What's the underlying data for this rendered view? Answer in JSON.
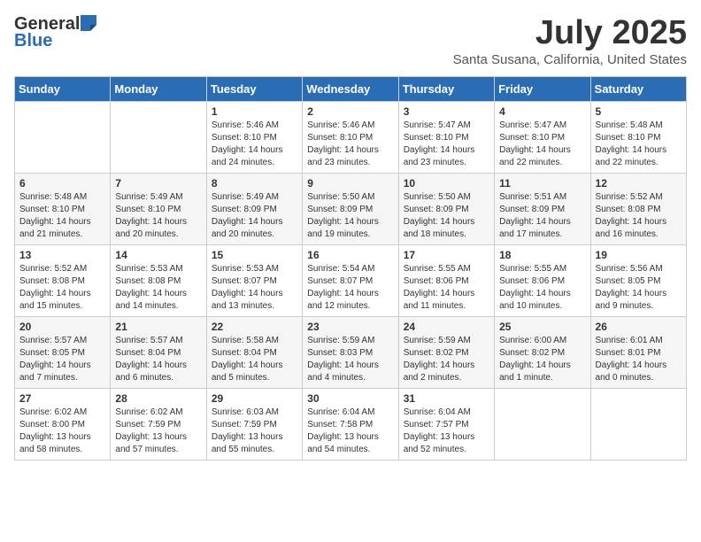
{
  "logo": {
    "general": "General",
    "blue": "Blue"
  },
  "title": "July 2025",
  "subtitle": "Santa Susana, California, United States",
  "headers": [
    "Sunday",
    "Monday",
    "Tuesday",
    "Wednesday",
    "Thursday",
    "Friday",
    "Saturday"
  ],
  "weeks": [
    [
      {
        "day": "",
        "sunrise": "",
        "sunset": "",
        "daylight": ""
      },
      {
        "day": "",
        "sunrise": "",
        "sunset": "",
        "daylight": ""
      },
      {
        "day": "1",
        "sunrise": "Sunrise: 5:46 AM",
        "sunset": "Sunset: 8:10 PM",
        "daylight": "Daylight: 14 hours and 24 minutes."
      },
      {
        "day": "2",
        "sunrise": "Sunrise: 5:46 AM",
        "sunset": "Sunset: 8:10 PM",
        "daylight": "Daylight: 14 hours and 23 minutes."
      },
      {
        "day": "3",
        "sunrise": "Sunrise: 5:47 AM",
        "sunset": "Sunset: 8:10 PM",
        "daylight": "Daylight: 14 hours and 23 minutes."
      },
      {
        "day": "4",
        "sunrise": "Sunrise: 5:47 AM",
        "sunset": "Sunset: 8:10 PM",
        "daylight": "Daylight: 14 hours and 22 minutes."
      },
      {
        "day": "5",
        "sunrise": "Sunrise: 5:48 AM",
        "sunset": "Sunset: 8:10 PM",
        "daylight": "Daylight: 14 hours and 22 minutes."
      }
    ],
    [
      {
        "day": "6",
        "sunrise": "Sunrise: 5:48 AM",
        "sunset": "Sunset: 8:10 PM",
        "daylight": "Daylight: 14 hours and 21 minutes."
      },
      {
        "day": "7",
        "sunrise": "Sunrise: 5:49 AM",
        "sunset": "Sunset: 8:10 PM",
        "daylight": "Daylight: 14 hours and 20 minutes."
      },
      {
        "day": "8",
        "sunrise": "Sunrise: 5:49 AM",
        "sunset": "Sunset: 8:09 PM",
        "daylight": "Daylight: 14 hours and 20 minutes."
      },
      {
        "day": "9",
        "sunrise": "Sunrise: 5:50 AM",
        "sunset": "Sunset: 8:09 PM",
        "daylight": "Daylight: 14 hours and 19 minutes."
      },
      {
        "day": "10",
        "sunrise": "Sunrise: 5:50 AM",
        "sunset": "Sunset: 8:09 PM",
        "daylight": "Daylight: 14 hours and 18 minutes."
      },
      {
        "day": "11",
        "sunrise": "Sunrise: 5:51 AM",
        "sunset": "Sunset: 8:09 PM",
        "daylight": "Daylight: 14 hours and 17 minutes."
      },
      {
        "day": "12",
        "sunrise": "Sunrise: 5:52 AM",
        "sunset": "Sunset: 8:08 PM",
        "daylight": "Daylight: 14 hours and 16 minutes."
      }
    ],
    [
      {
        "day": "13",
        "sunrise": "Sunrise: 5:52 AM",
        "sunset": "Sunset: 8:08 PM",
        "daylight": "Daylight: 14 hours and 15 minutes."
      },
      {
        "day": "14",
        "sunrise": "Sunrise: 5:53 AM",
        "sunset": "Sunset: 8:08 PM",
        "daylight": "Daylight: 14 hours and 14 minutes."
      },
      {
        "day": "15",
        "sunrise": "Sunrise: 5:53 AM",
        "sunset": "Sunset: 8:07 PM",
        "daylight": "Daylight: 14 hours and 13 minutes."
      },
      {
        "day": "16",
        "sunrise": "Sunrise: 5:54 AM",
        "sunset": "Sunset: 8:07 PM",
        "daylight": "Daylight: 14 hours and 12 minutes."
      },
      {
        "day": "17",
        "sunrise": "Sunrise: 5:55 AM",
        "sunset": "Sunset: 8:06 PM",
        "daylight": "Daylight: 14 hours and 11 minutes."
      },
      {
        "day": "18",
        "sunrise": "Sunrise: 5:55 AM",
        "sunset": "Sunset: 8:06 PM",
        "daylight": "Daylight: 14 hours and 10 minutes."
      },
      {
        "day": "19",
        "sunrise": "Sunrise: 5:56 AM",
        "sunset": "Sunset: 8:05 PM",
        "daylight": "Daylight: 14 hours and 9 minutes."
      }
    ],
    [
      {
        "day": "20",
        "sunrise": "Sunrise: 5:57 AM",
        "sunset": "Sunset: 8:05 PM",
        "daylight": "Daylight: 14 hours and 7 minutes."
      },
      {
        "day": "21",
        "sunrise": "Sunrise: 5:57 AM",
        "sunset": "Sunset: 8:04 PM",
        "daylight": "Daylight: 14 hours and 6 minutes."
      },
      {
        "day": "22",
        "sunrise": "Sunrise: 5:58 AM",
        "sunset": "Sunset: 8:04 PM",
        "daylight": "Daylight: 14 hours and 5 minutes."
      },
      {
        "day": "23",
        "sunrise": "Sunrise: 5:59 AM",
        "sunset": "Sunset: 8:03 PM",
        "daylight": "Daylight: 14 hours and 4 minutes."
      },
      {
        "day": "24",
        "sunrise": "Sunrise: 5:59 AM",
        "sunset": "Sunset: 8:02 PM",
        "daylight": "Daylight: 14 hours and 2 minutes."
      },
      {
        "day": "25",
        "sunrise": "Sunrise: 6:00 AM",
        "sunset": "Sunset: 8:02 PM",
        "daylight": "Daylight: 14 hours and 1 minute."
      },
      {
        "day": "26",
        "sunrise": "Sunrise: 6:01 AM",
        "sunset": "Sunset: 8:01 PM",
        "daylight": "Daylight: 14 hours and 0 minutes."
      }
    ],
    [
      {
        "day": "27",
        "sunrise": "Sunrise: 6:02 AM",
        "sunset": "Sunset: 8:00 PM",
        "daylight": "Daylight: 13 hours and 58 minutes."
      },
      {
        "day": "28",
        "sunrise": "Sunrise: 6:02 AM",
        "sunset": "Sunset: 7:59 PM",
        "daylight": "Daylight: 13 hours and 57 minutes."
      },
      {
        "day": "29",
        "sunrise": "Sunrise: 6:03 AM",
        "sunset": "Sunset: 7:59 PM",
        "daylight": "Daylight: 13 hours and 55 minutes."
      },
      {
        "day": "30",
        "sunrise": "Sunrise: 6:04 AM",
        "sunset": "Sunset: 7:58 PM",
        "daylight": "Daylight: 13 hours and 54 minutes."
      },
      {
        "day": "31",
        "sunrise": "Sunrise: 6:04 AM",
        "sunset": "Sunset: 7:57 PM",
        "daylight": "Daylight: 13 hours and 52 minutes."
      },
      {
        "day": "",
        "sunrise": "",
        "sunset": "",
        "daylight": ""
      },
      {
        "day": "",
        "sunrise": "",
        "sunset": "",
        "daylight": ""
      }
    ]
  ]
}
